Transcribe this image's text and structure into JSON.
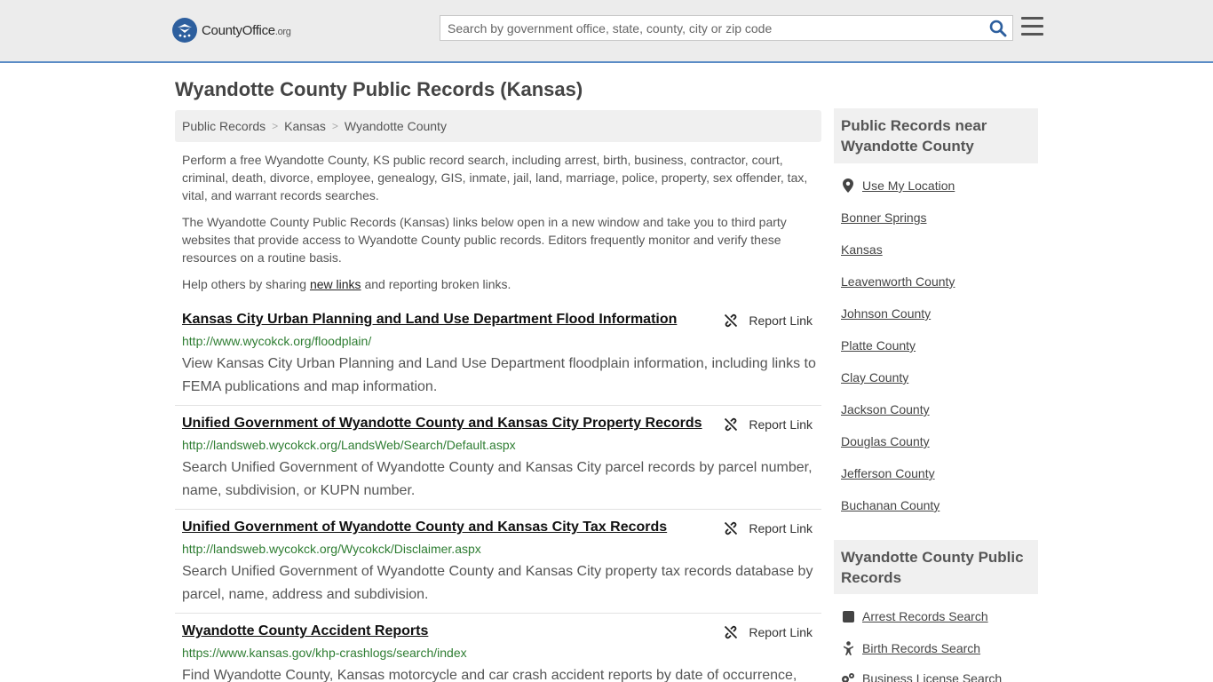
{
  "header": {
    "logo_main": "CountyOffice",
    "logo_suffix": ".org",
    "search_placeholder": "Search by government office, state, county, city or zip code"
  },
  "page": {
    "title": "Wyandotte County Public Records (Kansas)"
  },
  "breadcrumb": [
    "Public Records",
    "Kansas",
    "Wyandotte County"
  ],
  "intro": {
    "p1": "Perform a free Wyandotte County, KS public record search, including arrest, birth, business, contractor, court, criminal, death, divorce, employee, genealogy, GIS, inmate, jail, land, marriage, police, property, sex offender, tax, vital, and warrant records searches.",
    "p2": "The Wyandotte County Public Records (Kansas) links below open in a new window and take you to third party websites that provide access to Wyandotte County public records. Editors frequently monitor and verify these resources on a routine basis.",
    "p3_before": "Help others by sharing ",
    "p3_link": "new links",
    "p3_after": " and reporting broken links."
  },
  "report_label": "Report Link",
  "records": [
    {
      "title": "Kansas City Urban Planning and Land Use Department Flood Information",
      "url": "http://www.wycokck.org/floodplain/",
      "desc": "View Kansas City Urban Planning and Land Use Department floodplain information, including links to FEMA publications and map information."
    },
    {
      "title": "Unified Government of Wyandotte County and Kansas City Property Records",
      "url": "http://landsweb.wycokck.org/LandsWeb/Search/Default.aspx",
      "desc": "Search Unified Government of Wyandotte County and Kansas City parcel records by parcel number, name, subdivision, or KUPN number."
    },
    {
      "title": "Unified Government of Wyandotte County and Kansas City Tax Records",
      "url": "http://landsweb.wycokck.org/Wycokck/Disclaimer.aspx",
      "desc": "Search Unified Government of Wyandotte County and Kansas City property tax records database by parcel, name, address and subdivision."
    },
    {
      "title": "Wyandotte County Accident Reports",
      "url": "https://www.kansas.gov/khp-crashlogs/search/index",
      "desc": "Find Wyandotte County, Kansas motorcycle and car crash accident reports by date of occurrence,"
    }
  ],
  "sidebar": {
    "near_heading": "Public Records near Wyandotte County",
    "near_items": [
      "Use My Location",
      "Bonner Springs",
      "Kansas",
      "Leavenworth County",
      "Johnson County",
      "Platte County",
      "Clay County",
      "Jackson County",
      "Douglas County",
      "Jefferson County",
      "Buchanan County"
    ],
    "county_heading": "Wyandotte County Public Records",
    "county_items": [
      {
        "label": "Arrest Records Search",
        "icon": "square-icon"
      },
      {
        "label": "Birth Records Search",
        "icon": "baby-icon"
      },
      {
        "label": "Business License Search",
        "icon": "gears-icon"
      }
    ]
  }
}
